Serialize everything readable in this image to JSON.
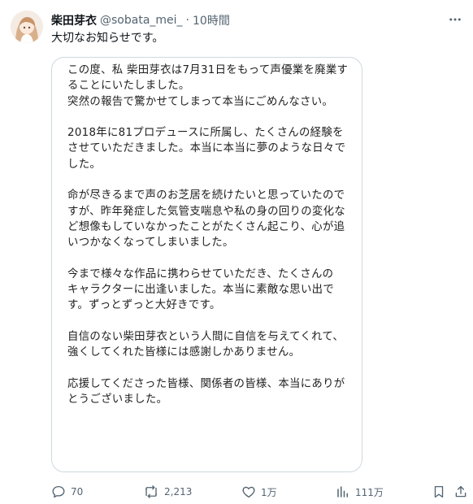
{
  "post": {
    "display_name": "柴田芽衣",
    "handle": "@sobata_mei_",
    "separator": "·",
    "time": "10時間",
    "text": "大切なお知らせです。"
  },
  "statement": {
    "paragraphs": [
      {
        "lines": [
          "この度、私 柴田芽衣は7月31日をもって声優業を廃業す",
          "ることにいたしました。",
          "突然の報告で驚かせてしまって本当にごめんなさい。"
        ]
      },
      {
        "lines": [
          "2018年に81プロデュースに所属し、たくさんの経験を",
          "させていただきました。本当に本当に夢のような日々で",
          "した。"
        ]
      },
      {
        "lines": [
          "命が尽きるまで声のお芝居を続けたいと思っていたので",
          "すが、昨年発症した気管支喘息や私の身の回りの変化な",
          "ど想像もしていなかったことがたくさん起こり、心が追",
          "いつかなくなってしまいました。"
        ]
      },
      {
        "lines": [
          "今まで様々な作品に携わらせていただき、たくさんの",
          "キャラクターに出逢いました。本当に素敵な思い出で",
          "す。ずっとずっと大好きです。"
        ]
      },
      {
        "lines": [
          "自信のない柴田芽衣という人間に自信を与えてくれて、",
          "強くしてくれた皆様には感謝しかありません。"
        ]
      },
      {
        "lines": [
          "応援してくださった皆様、関係者の皆様、本当にありが",
          "とうございました。"
        ]
      }
    ]
  },
  "actions": {
    "replies": "70",
    "reposts": "2,213",
    "likes": "1万",
    "views": "111万"
  },
  "icons": {
    "more": "more-horizontal-icon",
    "reply": "reply-icon",
    "repost": "repost-icon",
    "like": "heart-icon",
    "views": "views-icon",
    "bookmark": "bookmark-icon",
    "share": "share-icon"
  },
  "colors": {
    "text": "#0f1419",
    "muted": "#536471",
    "border": "#cfd9de"
  }
}
